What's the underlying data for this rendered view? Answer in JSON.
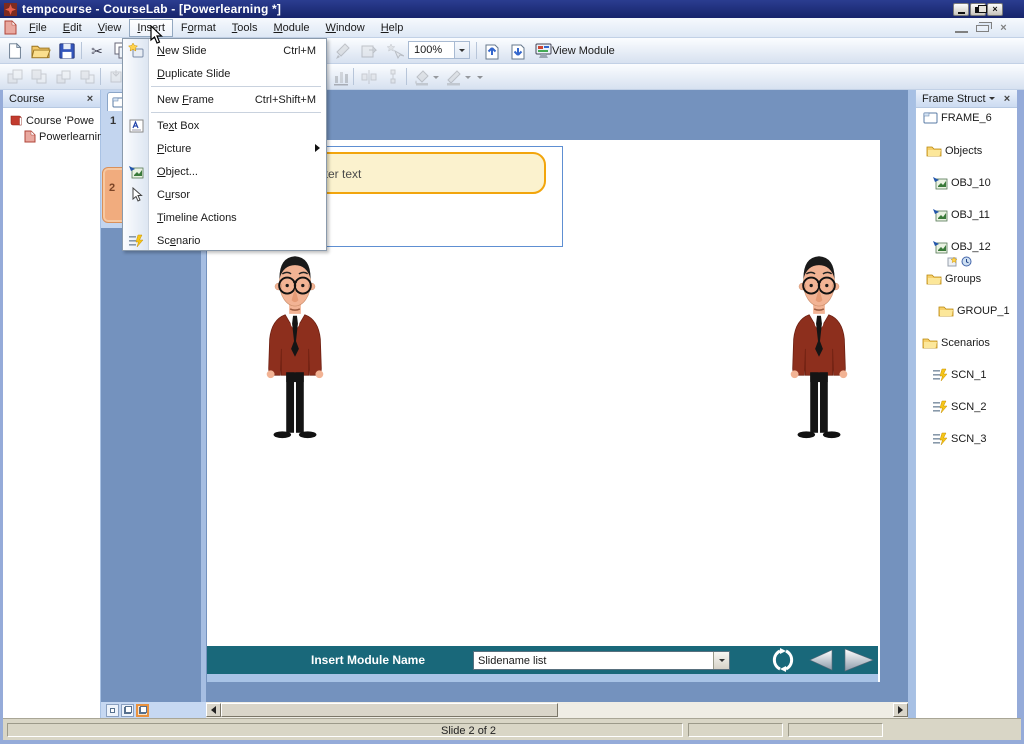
{
  "window": {
    "title": "tempcourse - CourseLab - [Powerlearning *]"
  },
  "menubar": {
    "items": [
      {
        "pre": "",
        "key": "F",
        "post": "ile"
      },
      {
        "pre": "",
        "key": "E",
        "post": "dit"
      },
      {
        "pre": "",
        "key": "V",
        "post": "iew"
      },
      {
        "pre": "",
        "key": "I",
        "post": "nsert"
      },
      {
        "pre": "F",
        "key": "o",
        "post": "rmat"
      },
      {
        "pre": "",
        "key": "T",
        "post": "ools"
      },
      {
        "pre": "",
        "key": "M",
        "post": "odule"
      },
      {
        "pre": "",
        "key": "W",
        "post": "indow"
      },
      {
        "pre": "",
        "key": "H",
        "post": "elp"
      }
    ]
  },
  "toolbar": {
    "zoom_value": "100%",
    "view_module_label": "View Module"
  },
  "insert_menu": {
    "items": [
      {
        "pre": "",
        "key": "N",
        "post": "ew Slide",
        "shortcut": "Ctrl+M"
      },
      {
        "pre": "",
        "key": "D",
        "post": "uplicate Slide",
        "shortcut": ""
      },
      {
        "pre": "New ",
        "key": "F",
        "post": "rame",
        "shortcut": "Ctrl+Shift+M"
      },
      {
        "pre": "Te",
        "key": "x",
        "post": "t Box",
        "shortcut": ""
      },
      {
        "pre": "",
        "key": "P",
        "post": "icture",
        "shortcut": ""
      },
      {
        "pre": "",
        "key": "O",
        "post": "bject...",
        "shortcut": ""
      },
      {
        "pre": "C",
        "key": "u",
        "post": "rsor",
        "shortcut": ""
      },
      {
        "pre": "",
        "key": "T",
        "post": "imeline Actions",
        "shortcut": ""
      },
      {
        "pre": "Sc",
        "key": "e",
        "post": "nario",
        "shortcut": ""
      }
    ]
  },
  "course_panel": {
    "title": "Course",
    "items": [
      {
        "label": "Course 'Powe"
      },
      {
        "label": "Powerlearnin"
      }
    ]
  },
  "slides_panel": {
    "slide1": "1",
    "slide2": "2"
  },
  "frame_panel": {
    "title": "Frame Struct",
    "nodes": [
      {
        "label": "FRAME_6"
      },
      {
        "label": "Objects"
      },
      {
        "label": "OBJ_10"
      },
      {
        "label": "OBJ_11"
      },
      {
        "label": "OBJ_12"
      },
      {
        "label": "Groups"
      },
      {
        "label": "GROUP_1"
      },
      {
        "label": "Scenarios"
      },
      {
        "label": "SCN_1"
      },
      {
        "label": "SCN_2"
      },
      {
        "label": "SCN_3"
      }
    ]
  },
  "slide": {
    "callout_text": "Enter text"
  },
  "player_bar": {
    "title": "Insert Module Name",
    "dropdown_value": "Slidename list"
  },
  "statusbar": {
    "slide_label": "Slide 2 of 2"
  },
  "glyphs": {
    "close": "×",
    "cut": "✂"
  },
  "colors": {
    "titlebar": "#1C2A74",
    "canvas": "#7492BE",
    "teal_bar": "#19687A",
    "callout_bg": "#FBF2CE",
    "callout_border": "#F2A50C",
    "selected_slide": "#F1AC7E",
    "status_bg": "#D9D6C6"
  }
}
